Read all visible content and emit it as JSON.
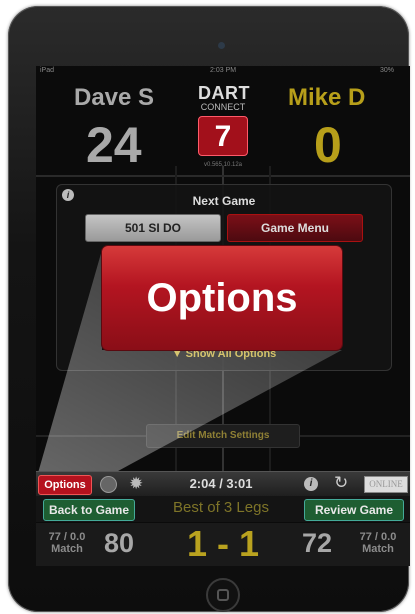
{
  "status_bar": {
    "left": "iPad",
    "center": "2:03 PM",
    "right": "30%"
  },
  "logo": {
    "line1": "DART",
    "line2": "CONNECT"
  },
  "players": {
    "left": {
      "name": "Dave S",
      "score": "24",
      "color": "#a9a9a9"
    },
    "right": {
      "name": "Mike D",
      "score": "0",
      "color": "#b79f1a"
    }
  },
  "dart_count": "7",
  "version": "v0.565.10.12a",
  "panel": {
    "title": "Next Game",
    "game_button": "501 SI DO",
    "menu_button": "Game Menu",
    "show_all": "▼ Show All Options"
  },
  "callout": {
    "label": "Options",
    "color": "#b41521"
  },
  "edit_match": "Edit Match Settings",
  "toolbar": {
    "options": "Options",
    "time": "2:04 / 3:01",
    "online": "ONLINE"
  },
  "bar2": {
    "back": "Back to Game",
    "bestof": "Best of 3 Legs",
    "review": "Review Game"
  },
  "bar3": {
    "left_avg": "77 / 0.0",
    "left_avg_label": "Match",
    "left_remaining": "80",
    "legs": "1 - 1",
    "right_remaining": "72",
    "right_avg": "77 / 0.0",
    "right_avg_label": "Match"
  },
  "icons": [
    "info-icon",
    "record-icon",
    "gear-icon",
    "refresh-icon",
    "home-button"
  ]
}
